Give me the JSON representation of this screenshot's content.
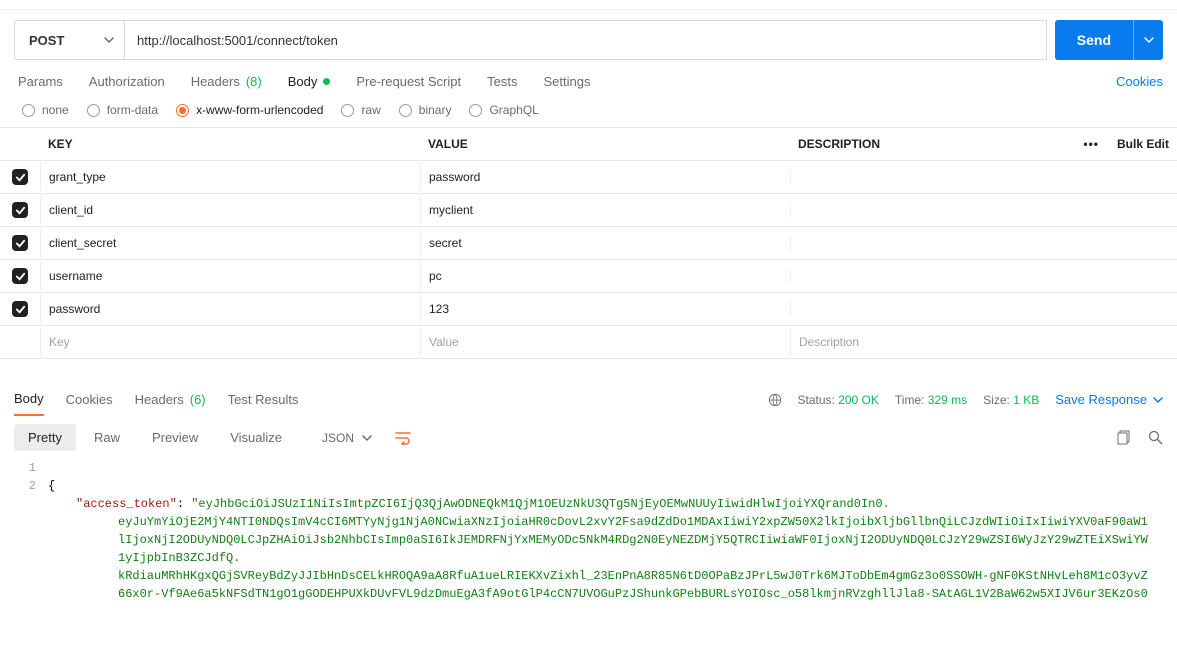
{
  "request": {
    "method": "POST",
    "url": "http://localhost:5001/connect/token",
    "send_label": "Send",
    "cookies_link": "Cookies",
    "tabs": {
      "params": "Params",
      "authorization": "Authorization",
      "headers": "Headers",
      "headers_count": "(8)",
      "body": "Body",
      "prerequest": "Pre-request Script",
      "tests": "Tests",
      "settings": "Settings"
    },
    "body_types": {
      "none": "none",
      "formdata": "form-data",
      "xwww": "x-www-form-urlencoded",
      "raw": "raw",
      "binary": "binary",
      "graphql": "GraphQL"
    },
    "kv_header": {
      "key": "KEY",
      "value": "VALUE",
      "desc": "DESCRIPTION",
      "bulk": "Bulk Edit"
    },
    "rows": [
      {
        "key": "grant_type",
        "value": "password"
      },
      {
        "key": "client_id",
        "value": "myclient"
      },
      {
        "key": "client_secret",
        "value": "secret"
      },
      {
        "key": "username",
        "value": "pc"
      },
      {
        "key": "password",
        "value": "123"
      }
    ],
    "placeholders": {
      "key": "Key",
      "value": "Value",
      "desc": "Description"
    }
  },
  "response": {
    "tabs": {
      "body": "Body",
      "cookies": "Cookies",
      "headers": "Headers",
      "headers_count": "(6)",
      "tests": "Test Results"
    },
    "status_label": "Status:",
    "status_value": "200 OK",
    "time_label": "Time:",
    "time_value": "329 ms",
    "size_label": "Size:",
    "size_value": "1 KB",
    "save_label": "Save Response",
    "view": {
      "pretty": "Pretty",
      "raw": "Raw",
      "preview": "Preview",
      "visualize": "Visualize",
      "format": "JSON"
    },
    "json": {
      "line1": "{",
      "key": "\"access_token\"",
      "sep": ": ",
      "val_line1": "\"eyJhbGciOiJSUzI1NiIsImtpZCI6IjQ3QjAwODNEQkM1QjM1OEUzNkU3QTg5NjEyOEMwNUUyIiwidHlwIjoiYXQrand0In0.",
      "val_line2": "eyJuYmYiOjE2MjY4NTI0NDQsImV4cCI6MTYyNjg1NjA0NCwiaXNzIjoiaHR0cDovL2xvY2Fsa9dZdDo1MDAxIiwiY2xpZW50X2lkIjoibXljbGllbnQiLCJzdWIiOiIxIiwiYXV0aF90aW1",
      "val_line3": "lIjoxNjI2ODUyNDQ0LCJpZHAiOiJsb2NhbCIsImp0aSI6IkJEMDRFNjYxMEMyODc5NkM4RDg2N0EyNEZDMjY5QTRCIiwiaWF0IjoxNjI2ODUyNDQ0LCJzY29wZSI6WyJzY29wZTEiXSwiYW",
      "val_line4": "1yIjpbInB3ZCJdfQ.",
      "val_line5": "kRdiauMRhHKgxQGjSVReyBdZyJJIbHnDsCELkHROQA9aA8RfuA1ueLRIEKXvZixhl_23EnPnA8R85N6tD0OPaBzJPrL5wJ0Trk6MJToDbEm4gmGz3o0SSOWH-gNF0KStNHvLeh8M1cO3yvZ",
      "val_line6": "66x0r-Vf9Ae6a5kNFSdTN1gO1gGODEHPUXkDUvFVL9dzDmuEgA3fA9otGlP4cCN7UVOGuPzJShunkGPebBURLsYOIOsc_o58lkmjnRVzghllJla8-SAtAGL1V2BaW62w5XIJV6ur3EKzOs0"
    }
  }
}
